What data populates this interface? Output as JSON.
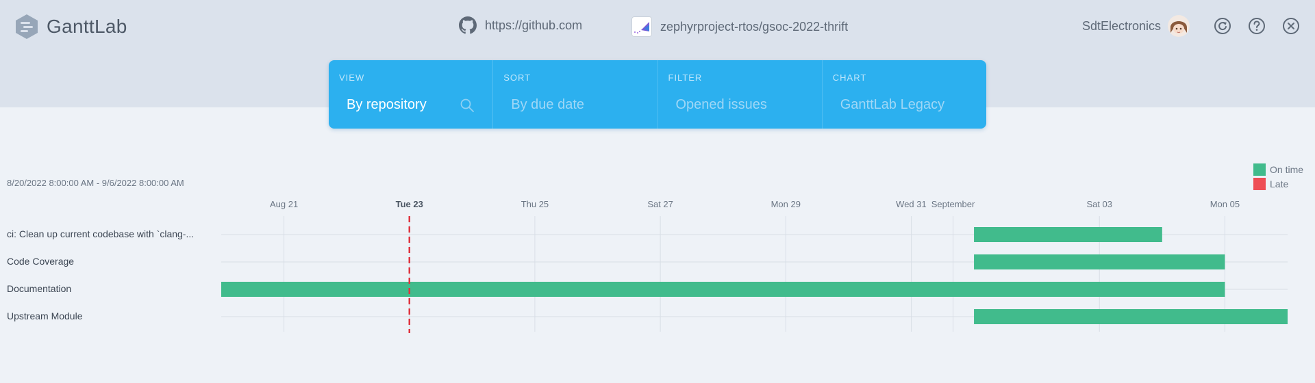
{
  "app": {
    "name": "GanttLab"
  },
  "header": {
    "source_url": "https://github.com",
    "project_path": "zephyrproject-rtos/gsoc-2022-thrift",
    "username": "SdtElectronics"
  },
  "controls": {
    "view": {
      "label": "VIEW",
      "value": "By repository"
    },
    "sort": {
      "label": "SORT",
      "value": "By due date"
    },
    "filter": {
      "label": "FILTER",
      "value": "Opened issues"
    },
    "chart": {
      "label": "CHART",
      "value": "GanttLab Legacy"
    }
  },
  "colors": {
    "accent": "#2cb0ef",
    "on_time": "#41bb8c",
    "late": "#ee4e55",
    "today_line": "#e0343f"
  },
  "chart_data": {
    "type": "gantt",
    "date_range_text": "8/20/2022 8:00:00 AM - 9/6/2022 8:00:00 AM",
    "x_start": "2022-08-20T08:00",
    "x_end": "2022-09-06T08:00",
    "ticks": [
      {
        "date": "2022-08-21",
        "label": "Aug 21",
        "bold": false
      },
      {
        "date": "2022-08-23",
        "label": "Tue 23",
        "bold": true
      },
      {
        "date": "2022-08-25",
        "label": "Thu 25",
        "bold": false
      },
      {
        "date": "2022-08-27",
        "label": "Sat 27",
        "bold": false
      },
      {
        "date": "2022-08-29",
        "label": "Mon 29",
        "bold": false
      },
      {
        "date": "2022-08-31",
        "label": "Wed 31",
        "bold": false
      },
      {
        "date": "2022-09-01",
        "label": "September",
        "bold": false
      },
      {
        "date": "2022-09-03",
        "label": "Sat 03",
        "bold": false
      },
      {
        "date": "2022-09-05",
        "label": "Mon 05",
        "bold": false
      }
    ],
    "today": "2022-08-23",
    "legend": [
      {
        "label": "On time",
        "status": "on_time"
      },
      {
        "label": "Late",
        "status": "late"
      }
    ],
    "tasks": [
      {
        "name": "ci: Clean up current codebase with `clang-...",
        "start": "2022-09-01T08:00",
        "end": "2022-09-04T08:00",
        "status": "on_time"
      },
      {
        "name": "Code Coverage",
        "start": "2022-09-01T08:00",
        "end": "2022-09-05T08:00",
        "status": "on_time"
      },
      {
        "name": "Documentation",
        "start": "2022-08-20T08:00",
        "end": "2022-09-05T08:00",
        "status": "on_time"
      },
      {
        "name": "Upstream Module",
        "start": "2022-09-01T08:00",
        "end": "2022-09-06T08:00",
        "status": "on_time"
      }
    ]
  }
}
